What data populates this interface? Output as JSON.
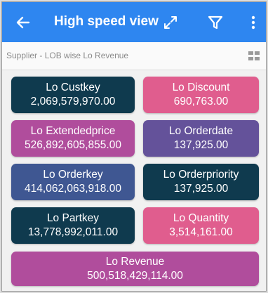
{
  "header": {
    "title": "High speed view",
    "back_icon": "arrow-left-icon",
    "actions": [
      "expand-icon",
      "filter-icon",
      "more-vert-icon"
    ],
    "color": "#2e86f0"
  },
  "subheader": {
    "text": "Supplier - LOB wise Lo Revenue",
    "icon": "grid-view-icon"
  },
  "tiles": [
    {
      "label": "Lo Custkey",
      "value": "2,069,579,970.00",
      "color": "#0f3a4e"
    },
    {
      "label": "Lo Discount",
      "value": "690,763.00",
      "color": "#e05d8e"
    },
    {
      "label": "Lo Extendedprice",
      "value": "526,892,605,855.00",
      "color": "#b04d9c"
    },
    {
      "label": "Lo Orderdate",
      "value": "137,925.00",
      "color": "#64529a"
    },
    {
      "label": "Lo Orderkey",
      "value": "414,062,063,918.00",
      "color": "#3f5792"
    },
    {
      "label": "Lo Orderpriority",
      "value": "137,925.00",
      "color": "#0f3a4e"
    },
    {
      "label": "Lo Partkey",
      "value": "13,778,992,011.00",
      "color": "#0f3a4e"
    },
    {
      "label": "Lo Quantity",
      "value": "3,514,161.00",
      "color": "#e05d8e"
    },
    {
      "label": "Lo Revenue",
      "value": "500,518,429,114.00",
      "color": "#b04d9c"
    }
  ]
}
